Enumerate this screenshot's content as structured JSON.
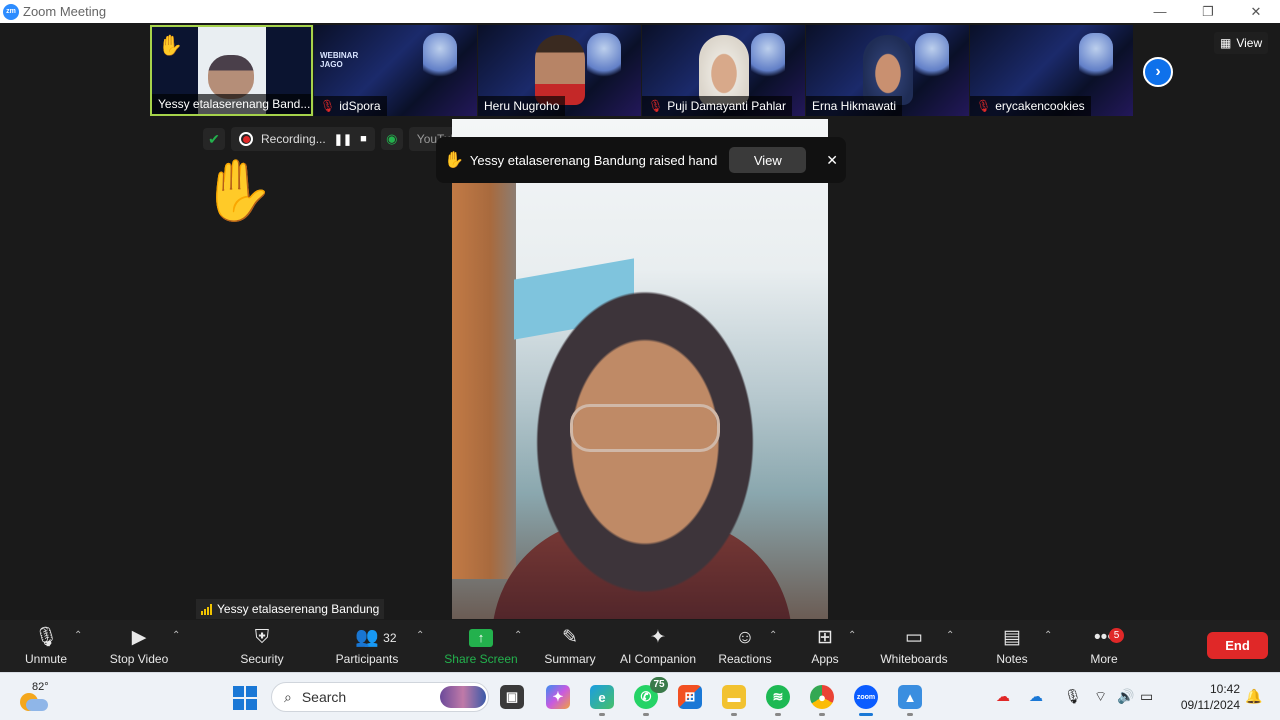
{
  "window": {
    "title": "Zoom Meeting",
    "logo_text": "zm"
  },
  "window_controls": {
    "minimize": "—",
    "restore": "❐",
    "close": "✕"
  },
  "view_button": {
    "label": "View"
  },
  "participants_strip": [
    {
      "name": "Yessy etalaserenang Band...",
      "hand_raised": true,
      "muted": false,
      "active": true
    },
    {
      "name": "idSpora",
      "muted": true
    },
    {
      "name": "Heru Nugroho",
      "muted": false
    },
    {
      "name": "Puji Damayanti Pahlar",
      "muted": true
    },
    {
      "name": "Erna Hikmawati",
      "muted": false
    },
    {
      "name": "erycakencookies",
      "muted": true
    }
  ],
  "recording": {
    "status": "Recording...",
    "stream_target": "YouTube"
  },
  "notification": {
    "message": "Yessy etalaserenang Bandung raised hand",
    "view_label": "View",
    "close": "✕"
  },
  "active_speaker": {
    "name": "Yessy etalaserenang Bandung"
  },
  "toolbar": {
    "unmute": "Unmute",
    "stop_video": "Stop Video",
    "security": "Security",
    "participants": "Participants",
    "participants_count": "32",
    "share_screen": "Share Screen",
    "summary": "Summary",
    "ai_companion": "AI Companion",
    "reactions": "Reactions",
    "apps": "Apps",
    "whiteboards": "Whiteboards",
    "notes": "Notes",
    "more": "More",
    "more_badge": "5",
    "end": "End"
  },
  "taskbar": {
    "weather_temp": "82°",
    "search_placeholder": "Search",
    "whatsapp_badge": "75",
    "time": "10:42",
    "date": "09/11/2024",
    "zoom_icon_text": "zoom"
  },
  "colors": {
    "accent": "#0e71eb",
    "end": "#e02828",
    "share": "#23b14d",
    "active_border": "#a6d34b"
  }
}
